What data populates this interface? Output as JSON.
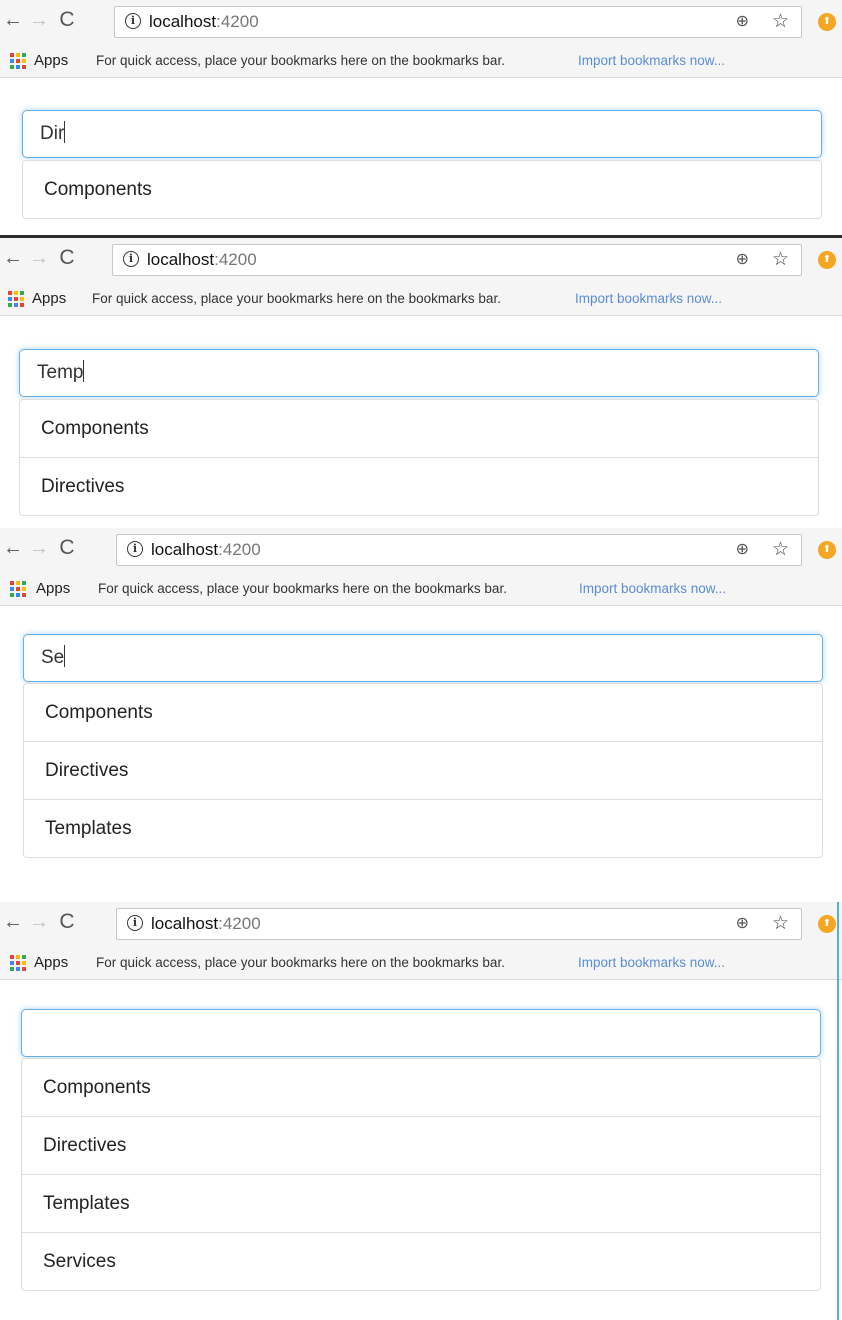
{
  "browser": {
    "url_host": "localhost",
    "url_port": ":4200",
    "apps_label": "Apps",
    "bookmarks_hint": "For quick access, place your bookmarks here on the bookmarks bar.",
    "import_link": "Import bookmarks now...",
    "accent_color": "#5a8dd6"
  },
  "icons": {
    "back": "←",
    "forward": "→",
    "reload": "C",
    "info": "i",
    "zoom": "⊕",
    "star": "☆",
    "extension": "⬆"
  },
  "panels": [
    {
      "search_value": "Dir",
      "items": [
        "Components"
      ]
    },
    {
      "search_value": "Temp",
      "items": [
        "Components",
        "Directives"
      ]
    },
    {
      "search_value": "Se",
      "items": [
        "Components",
        "Directives",
        "Templates"
      ]
    },
    {
      "search_value": "",
      "items": [
        "Components",
        "Directives",
        "Templates",
        "Services"
      ]
    }
  ]
}
